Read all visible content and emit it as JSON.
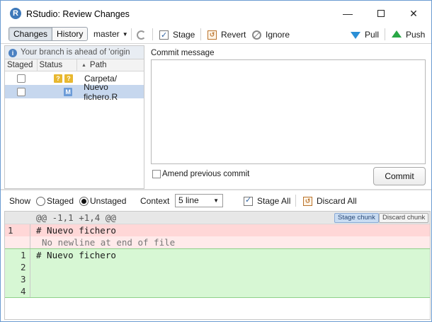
{
  "window": {
    "title": "RStudio: Review Changes",
    "app_icon": "R",
    "minimize_glyph": "—",
    "close_glyph": "✕"
  },
  "toolbar": {
    "changes_label": "Changes",
    "history_label": "History",
    "branch": "master",
    "stage_label": "Stage",
    "revert_label": "Revert",
    "ignore_label": "Ignore",
    "pull_label": "Pull",
    "push_label": "Push"
  },
  "files": {
    "banner": "Your branch is ahead of 'origin",
    "headers": {
      "staged": "Staged",
      "status": "Status",
      "path": "Path"
    },
    "rows": [
      {
        "path": "Carpeta/",
        "status_badges": [
          "?",
          "?"
        ],
        "selected": false
      },
      {
        "path": "Nuevo fichero.R",
        "status_badges": [
          "M"
        ],
        "selected": true
      }
    ]
  },
  "commit": {
    "label": "Commit message",
    "message": "",
    "amend_label": "Amend previous commit",
    "button_label": "Commit"
  },
  "diff_options": {
    "show_label": "Show",
    "staged_label": "Staged",
    "unstaged_label": "Unstaged",
    "selected_view": "Unstaged",
    "context_label": "Context",
    "context_value": "5 line",
    "stage_all_label": "Stage All",
    "discard_all_label": "Discard All"
  },
  "diff": {
    "hunk_header": "@@ -1,1 +1,4 @@",
    "stage_chunk_label": "Stage chunk",
    "discard_chunk_label": "Discard chunk",
    "removed": [
      {
        "old": "1",
        "text": "# Nuevo fichero"
      }
    ],
    "no_newline": "No newline at end of file",
    "added": [
      {
        "new": "1",
        "text": "# Nuevo fichero"
      },
      {
        "new": "2",
        "text": ""
      },
      {
        "new": "3",
        "text": ""
      },
      {
        "new": "4",
        "text": ""
      }
    ]
  },
  "colors": {
    "accent": "#3d78b9",
    "removed_bg": "#ffd7d7",
    "added_bg": "#d7f7d4",
    "pull_arrow": "#2b8fd6",
    "push_arrow": "#28a745"
  }
}
